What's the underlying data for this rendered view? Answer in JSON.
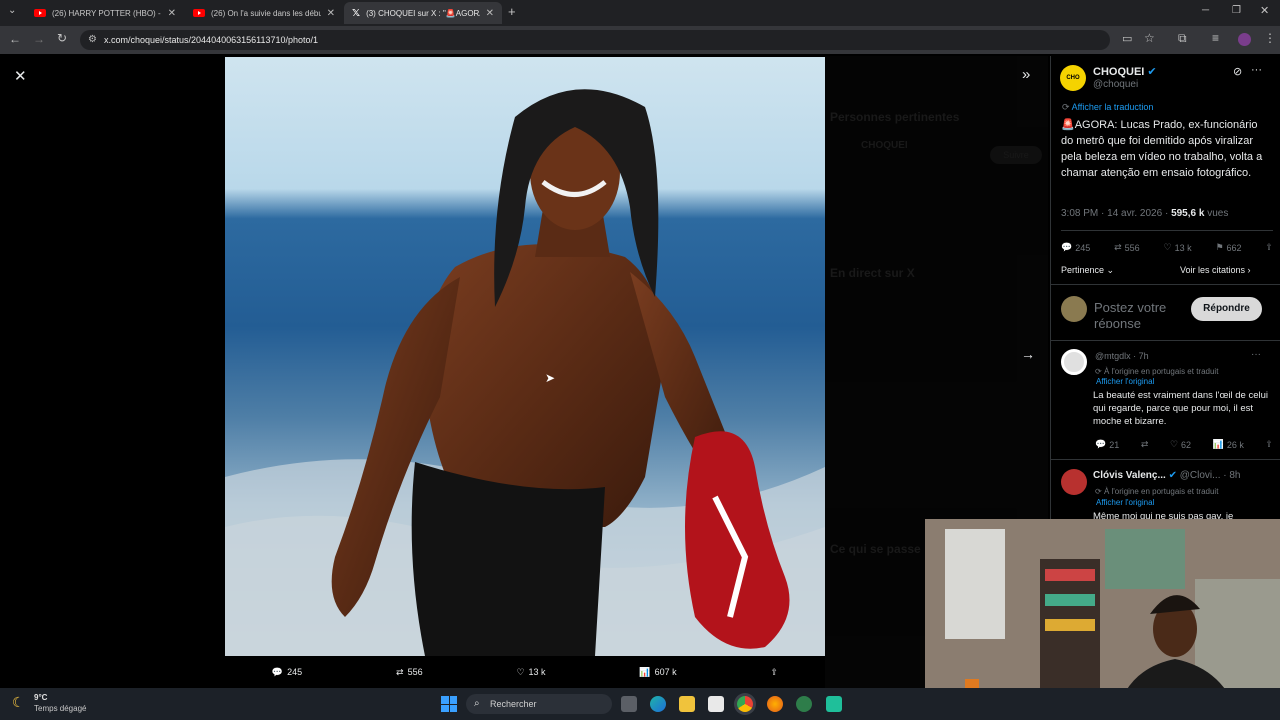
{
  "browser": {
    "tabs": [
      {
        "title": "(26) HARRY POTTER (HBO) - LE",
        "icon": "youtube-icon"
      },
      {
        "title": "(26) On l'a suivie dans les débu",
        "icon": "youtube-icon"
      },
      {
        "title": "(3) CHOQUEI sur X : \"🚨AGORA",
        "icon": "x-icon"
      }
    ],
    "new_tab_label": "+",
    "url": "x.com/choquei/status/2044040063156113710/photo/1"
  },
  "media": {
    "actions": {
      "replies": "245",
      "reposts": "556",
      "likes": "13 k",
      "views": "607 k"
    }
  },
  "background_sidebar": {
    "relevant_people_title": "Personnes pertinentes",
    "relevant_people_name": "CHOQUEI",
    "follow_label": "Suivre",
    "live_title": "En direct sur X",
    "happening_title": "Ce qui se passe"
  },
  "tweet": {
    "author_name": "CHOQUEI",
    "author_handle": "@choquei",
    "avatar_label": "CHO QUEI",
    "translate_label": "Afficher la traduction",
    "text": "🚨AGORA: Lucas Prado, ex-funcionário do metrô que foi demitido após viralizar pela beleza em vídeo no trabalho, volta a chamar atenção em ensaio fotográfico.",
    "time": "3:08 PM · 14 avr. 2026 ·",
    "views_count": "595,6 k",
    "views_label": "vues",
    "stats": {
      "replies": "245",
      "reposts": "556",
      "likes": "13 k",
      "bookmarks": "662"
    },
    "sort_label": "Pertinence",
    "quotes_label": "Voir les citations"
  },
  "composer": {
    "placeholder": "Postez votre réponse",
    "reply_button": "Répondre"
  },
  "replies": [
    {
      "handle": "@mtgdlx",
      "time": "· 7h",
      "origin": "À l'origine en portugais et traduit",
      "show_original": "Afficher l'original",
      "text": "La beauté est vraiment dans l'œil de celui qui regarde, parce que pour moi, il est moche et bizarre.",
      "replies": "21",
      "likes": "62",
      "views": "26 k"
    },
    {
      "name": "Clóvis Valenç...",
      "handle": "@Clovi...",
      "time": "· 8h",
      "origin": "À l'origine en portugais et traduit",
      "show_original": "Afficher l'original",
      "text": "Même moi qui ne suis pas gay, je"
    }
  ],
  "taskbar": {
    "temperature": "9°C",
    "weather": "Temps dégagé",
    "search_label": "Rechercher"
  },
  "colors": {
    "accent": "#1d9bf0",
    "background": "#000000",
    "panel_border": "#2f3336"
  }
}
